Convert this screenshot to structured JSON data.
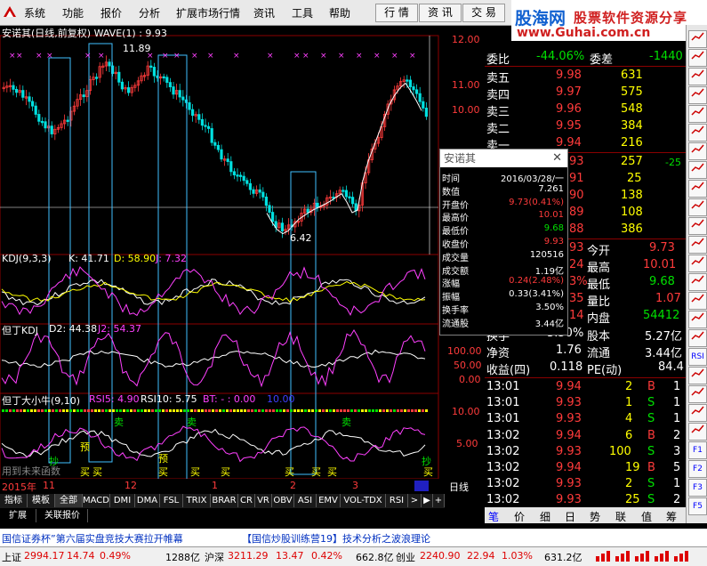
{
  "menu": [
    "系统",
    "功能",
    "报价",
    "分析",
    "扩展市场行情",
    "资讯",
    "工具",
    "帮助"
  ],
  "toolbar_tabs": [
    "行 情",
    "资 讯",
    "交 易"
  ],
  "brand": {
    "cn": "股海网",
    "slogan": "股票软件资源分享",
    "url": "www.Guhai.com.cn"
  },
  "main": {
    "title": "安诺其(日线,前复权) WAVE(1) : 9.93",
    "price_ticks": [
      "12.00",
      "11.00",
      "10.00",
      "9.00",
      "8.00",
      "7.00",
      "6.00"
    ],
    "high_label": "11.89",
    "low_label": "6.42"
  },
  "kdj": {
    "title": "KDJ(9,3,3)",
    "k": "K: 41.71",
    "d": "D: 58.90",
    "j": "J: 7.32"
  },
  "dingding": {
    "title": "但丁KDJ",
    "d2": "D2: 44.38",
    "j2": "J2: 54.37",
    "ticks": [
      "100.00",
      "50.00",
      "0.00"
    ]
  },
  "xiaoniu": {
    "title": "但丁大小牛(9,10)",
    "rsi5": "RSI5: 4.90",
    "rsi10": "RSI10: 5.75",
    "bt": "BT: - : 0.00",
    "bt2": "10.00",
    "ticks": [
      "10.00",
      "5.00"
    ],
    "tag": "用到未来函数"
  },
  "signals": {
    "buy": "买",
    "sell": "卖",
    "di": "抄",
    "yu": "预",
    "duo": "多"
  },
  "axis": {
    "year": "2015年",
    "months": [
      "11",
      "12",
      "1",
      "2",
      "3"
    ],
    "period_btn": "日线",
    "nav": [
      "▶",
      "+",
      "-"
    ]
  },
  "tabs": [
    "指标",
    "模板",
    "全部",
    "MACD",
    "DMI",
    "DMA",
    "FSL",
    "TRIX",
    "BRAR",
    "CR",
    "VR",
    "OBV",
    "ASI",
    "EMV",
    "VOL-TDX",
    "RSI",
    ">"
  ],
  "sub_tabs": [
    "扩展",
    "关联报价"
  ],
  "quote": {
    "weibi": {
      "label": "委比",
      "value": "-44.06%",
      "diff_label": "委差",
      "diff": "-1440"
    },
    "asks": [
      {
        "label": "卖五",
        "price": "9.98",
        "vol": "631"
      },
      {
        "label": "卖四",
        "price": "9.97",
        "vol": "575"
      },
      {
        "label": "卖三",
        "price": "9.96",
        "vol": "548"
      },
      {
        "label": "卖二",
        "price": "9.95",
        "vol": "384"
      },
      {
        "label": "卖一",
        "price": "9.94",
        "vol": "216"
      }
    ],
    "bids": [
      {
        "price": "93",
        "vol": "257",
        "chg": "-25"
      },
      {
        "price": "91",
        "vol": "25",
        "chg": ""
      },
      {
        "price": "90",
        "vol": "138",
        "chg": ""
      },
      {
        "price": "89",
        "vol": "108",
        "chg": ""
      },
      {
        "price": "88",
        "vol": "386",
        "chg": ""
      }
    ],
    "stats_left": [
      {
        "label": "93",
        "value": ""
      },
      {
        "label": "24",
        "value": ""
      },
      {
        "label": "3%",
        "value": ""
      },
      {
        "label": "35",
        "value": ""
      },
      {
        "label": "14",
        "value": ""
      }
    ],
    "stats_right": [
      {
        "label": "今开",
        "value": "9.73",
        "cls": "red"
      },
      {
        "label": "最高",
        "value": "10.01",
        "cls": "red"
      },
      {
        "label": "最低",
        "value": "9.68",
        "cls": "grn"
      },
      {
        "label": "量比",
        "value": "1.07",
        "cls": "red"
      },
      {
        "label": "内盘",
        "value": "54412",
        "cls": "grn"
      }
    ],
    "finance": [
      {
        "l": "换手",
        "v": "3.50%",
        "l2": "股本",
        "v2": "5.27亿"
      },
      {
        "l": "净资",
        "v": "1.76",
        "l2": "流通",
        "v2": "3.44亿"
      },
      {
        "l": "收益(四)",
        "v": "0.118",
        "l2": "PE(动)",
        "v2": "84.4"
      }
    ],
    "ticks": [
      {
        "t": "13:01",
        "p": "9.94",
        "v": "2",
        "bs": "B",
        "n": "1"
      },
      {
        "t": "13:01",
        "p": "9.93",
        "v": "1",
        "bs": "S",
        "n": "1"
      },
      {
        "t": "13:01",
        "p": "9.93",
        "v": "4",
        "bs": "S",
        "n": "1"
      },
      {
        "t": "13:02",
        "p": "9.94",
        "v": "6",
        "bs": "B",
        "n": "2"
      },
      {
        "t": "13:02",
        "p": "9.93",
        "v": "100",
        "bs": "S",
        "n": "3"
      },
      {
        "t": "13:02",
        "p": "9.94",
        "v": "19",
        "bs": "B",
        "n": "5"
      },
      {
        "t": "13:02",
        "p": "9.93",
        "v": "2",
        "bs": "S",
        "n": "1"
      },
      {
        "t": "13:02",
        "p": "9.93",
        "v": "25",
        "bs": "S",
        "n": "2"
      }
    ],
    "bottom_tabs": [
      "笔",
      "价",
      "细",
      "日",
      "势",
      "联",
      "值",
      "筹"
    ]
  },
  "popup": {
    "title": "安诺其",
    "rows": [
      {
        "k": "时间",
        "v": "2016/03/28/一",
        "c": "wht"
      },
      {
        "k": "数值",
        "v": "7.261",
        "c": "wht"
      },
      {
        "k": "开盘价",
        "v": "9.73(0.41%)",
        "c": "red"
      },
      {
        "k": "最高价",
        "v": "10.01",
        "c": "red"
      },
      {
        "k": "最低价",
        "v": "9.68",
        "c": "grn"
      },
      {
        "k": "收盘价",
        "v": "9.93",
        "c": "red"
      },
      {
        "k": "成交量",
        "v": "120516",
        "c": "wht"
      },
      {
        "k": "成交额",
        "v": "1.19亿",
        "c": "wht"
      },
      {
        "k": "涨幅",
        "v": "0.24(2.48%)",
        "c": "red"
      },
      {
        "k": "振幅",
        "v": "0.33(3.41%)",
        "c": "wht"
      },
      {
        "k": "换手率",
        "v": "3.50%",
        "c": "wht"
      },
      {
        "k": "流通股",
        "v": "3.44亿",
        "c": "wht"
      }
    ]
  },
  "ticker": {
    "left": "国信证券杯”第六届实盘竞技大赛拉开帷幕",
    "right": "【国信炒股训练营19】技术分析之波浪理论"
  },
  "status": {
    "sh_label": "上证",
    "sh": "2994.17",
    "sh_chg": "14.74",
    "sh_pct": "0.49%",
    "sh_amt": "1288亿",
    "sz_label": "沪深",
    "sz": "3211.29",
    "sz_chg": "13.47",
    "sz_pct": "0.42%",
    "sz_amt": "662.8亿",
    "cy_label": "创业",
    "cy": "2240.90",
    "cy_chg": "22.94",
    "cy_pct": "1.03%",
    "cy_amt": "631.2亿"
  },
  "right_toolbar": [
    "RSI",
    "F1",
    "F2",
    "F3",
    "F5",
    "F6",
    "F8",
    "F9"
  ],
  "colors": {
    "up": "#ff3b3b",
    "down": "#00e000",
    "bg": "#000000",
    "grid": "#8b0000"
  }
}
